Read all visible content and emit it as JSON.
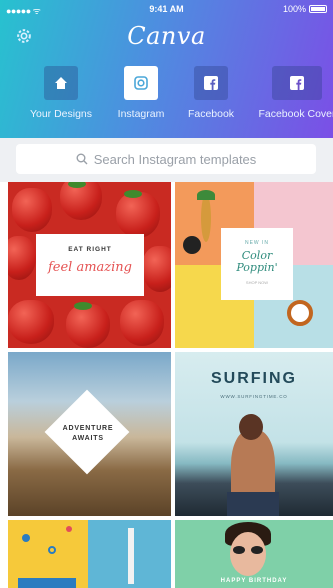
{
  "status_bar": {
    "carrier": "●●●●● ᯤ",
    "time": "9:41 AM",
    "battery": "100%"
  },
  "header": {
    "logo": "Canva"
  },
  "channels": [
    {
      "label": "Your Designs",
      "icon": "home-icon"
    },
    {
      "label": "Instagram",
      "icon": "instagram-icon"
    },
    {
      "label": "Facebook",
      "icon": "facebook-icon"
    },
    {
      "label": "Facebook Cover",
      "icon": "facebook-icon"
    }
  ],
  "search": {
    "placeholder": "Search Instagram templates"
  },
  "templates": [
    {
      "top": "EAT RIGHT",
      "main": "feel amazing"
    },
    {
      "top": "NEW IN",
      "main": "Color Poppin'",
      "foot": "SHOP NOW"
    },
    {
      "main": "ADVENTURE AWAITS"
    },
    {
      "main": "SURFING",
      "sub": "WWW.SURFINGTIME.CO"
    },
    {
      "main": ""
    },
    {
      "main": "HAPPY BIRTHDAY"
    }
  ],
  "colors": {
    "gradient_start": "#27c2cf",
    "gradient_end": "#7b4fe6",
    "search_bg": "#eef0f3"
  }
}
